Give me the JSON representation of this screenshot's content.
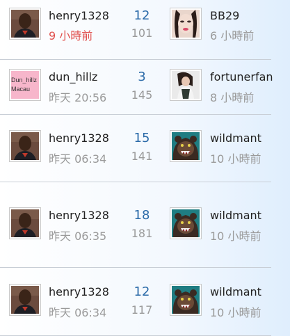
{
  "colors": {
    "accent_number": "#2a6aa8",
    "new_time": "#e0504d",
    "muted": "#9a9a9a"
  },
  "threads": [
    {
      "author": {
        "name": "henry1328",
        "time": "9 小時前",
        "avatar_icon": "henry-avatar"
      },
      "replies": "12",
      "views": "101",
      "last": {
        "name": "BB29",
        "time": "6 小時前",
        "avatar_icon": "bb29-avatar"
      }
    },
    {
      "author": {
        "name": "dun_hillz",
        "time": "昨天 20:56",
        "avatar_icon": "dun-hillz-avatar",
        "avatar_text": "Dun_hillz\nMacau"
      },
      "replies": "3",
      "views": "145",
      "last": {
        "name": "fortunerfan",
        "time": "8 小時前",
        "avatar_icon": "fortunerfan-avatar"
      }
    },
    {
      "author": {
        "name": "henry1328",
        "time": "昨天 06:34",
        "avatar_icon": "henry-avatar"
      },
      "replies": "15",
      "views": "141",
      "last": {
        "name": "wildmant",
        "time": "10 小時前",
        "avatar_icon": "grizzly-avatar"
      }
    },
    {
      "author": {
        "name": "henry1328",
        "time": "昨天 06:35",
        "avatar_icon": "henry-avatar"
      },
      "replies": "18",
      "views": "181",
      "last": {
        "name": "wildmant",
        "time": "10 小時前",
        "avatar_icon": "grizzly-avatar"
      }
    },
    {
      "author": {
        "name": "henry1328",
        "time": "昨天 06:34",
        "avatar_icon": "henry-avatar"
      },
      "replies": "12",
      "views": "117",
      "last": {
        "name": "wildmant",
        "time": "10 小時前",
        "avatar_icon": "grizzly-avatar"
      }
    }
  ]
}
